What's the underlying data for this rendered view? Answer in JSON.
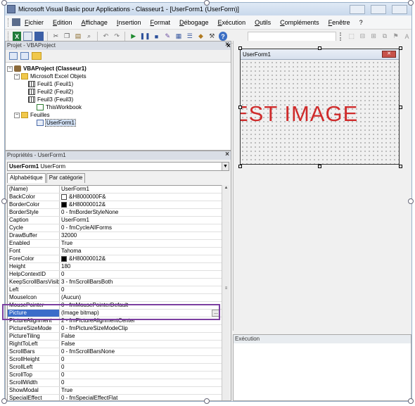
{
  "window": {
    "title": "Microsoft Visual Basic pour Applications - Classeur1 - [UserForm1 (UserForm)]"
  },
  "menu": {
    "items": [
      "Fichier",
      "Edition",
      "Affichage",
      "Insertion",
      "Format",
      "Débogage",
      "Exécution",
      "Outils",
      "Compléments",
      "Fenêtre",
      "?"
    ]
  },
  "project": {
    "title": "Projet - VBAProject",
    "root": "VBAProject (Classeur1)",
    "excel_objects": "Microsoft Excel Objets",
    "sheets": [
      "Feuil1 (Feuil1)",
      "Feuil2 (Feuil2)",
      "Feuil3 (Feuil3)"
    ],
    "workbook": "ThisWorkbook",
    "forms_folder": "Feuilles",
    "form": "UserForm1"
  },
  "properties": {
    "title": "Propriétés - UserForm1",
    "object_bold": "UserForm1",
    "object_type": "UserForm",
    "tabs": [
      "Alphabétique",
      "Par catégorie"
    ],
    "rows": [
      {
        "name": "(Name)",
        "value": "UserForm1"
      },
      {
        "name": "BackColor",
        "value": "&H8000000F&",
        "swatch": "#ffffff"
      },
      {
        "name": "BorderColor",
        "value": "&H80000012&",
        "swatch": "#000000"
      },
      {
        "name": "BorderStyle",
        "value": "0 - fmBorderStyleNone"
      },
      {
        "name": "Caption",
        "value": "UserForm1"
      },
      {
        "name": "Cycle",
        "value": "0 - fmCycleAllForms"
      },
      {
        "name": "DrawBuffer",
        "value": "32000"
      },
      {
        "name": "Enabled",
        "value": "True"
      },
      {
        "name": "Font",
        "value": "Tahoma"
      },
      {
        "name": "ForeColor",
        "value": "&H80000012&",
        "swatch": "#000000"
      },
      {
        "name": "Height",
        "value": "180"
      },
      {
        "name": "HelpContextID",
        "value": "0"
      },
      {
        "name": "KeepScrollBarsVisible",
        "value": "3 - fmScrollBarsBoth"
      },
      {
        "name": "Left",
        "value": "0"
      },
      {
        "name": "MouseIcon",
        "value": "(Aucun)"
      },
      {
        "name": "MousePointer",
        "value": "0 - fmMousePointerDefault"
      },
      {
        "name": "Picture",
        "value": "(Image bitmap)",
        "highlight": true
      },
      {
        "name": "PictureAlignment",
        "value": "2 - fmPictureAlignmentCenter"
      },
      {
        "name": "PictureSizeMode",
        "value": "0 - fmPictureSizeModeClip"
      },
      {
        "name": "PictureTiling",
        "value": "False"
      },
      {
        "name": "RightToLeft",
        "value": "False"
      },
      {
        "name": "ScrollBars",
        "value": "0 - fmScrollBarsNone"
      },
      {
        "name": "ScrollHeight",
        "value": "0"
      },
      {
        "name": "ScrollLeft",
        "value": "0"
      },
      {
        "name": "ScrollTop",
        "value": "0"
      },
      {
        "name": "ScrollWidth",
        "value": "0"
      },
      {
        "name": "ShowModal",
        "value": "True"
      },
      {
        "name": "SpecialEffect",
        "value": "0 - fmSpecialEffectFlat"
      }
    ]
  },
  "designer": {
    "form_caption": "UserForm1",
    "close_glyph": "✕",
    "picture_text": "EST IMAGE"
  },
  "execution": {
    "title": "Exécution"
  },
  "colors": {
    "picture_text": "#cf2b2b",
    "highlight_box": "#7b3fa0",
    "selected_row": "#3b6dc9"
  }
}
